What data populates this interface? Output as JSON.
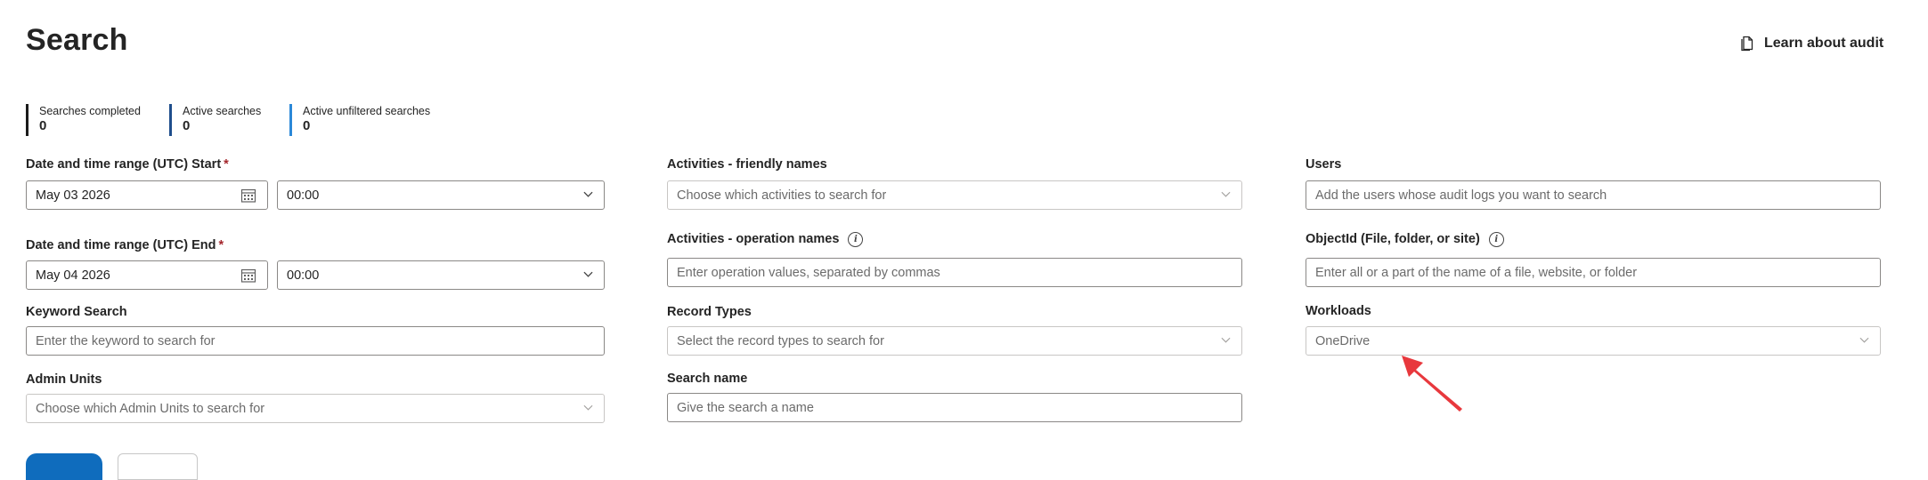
{
  "page": {
    "title": "Search",
    "learn_link": "Learn about audit"
  },
  "stats": [
    {
      "label": "Searches completed",
      "value": "0"
    },
    {
      "label": "Active searches",
      "value": "0"
    },
    {
      "label": "Active unfiltered searches",
      "value": "0"
    }
  ],
  "form": {
    "start": {
      "label": "Date and time range (UTC) Start",
      "required": "*",
      "date": "May 03 2026",
      "time": "00:00"
    },
    "end": {
      "label": "Date and time range (UTC) End",
      "required": "*",
      "date": "May 04 2026",
      "time": "00:00"
    },
    "keyword": {
      "label": "Keyword Search",
      "placeholder": "Enter the keyword to search for"
    },
    "admin_units": {
      "label": "Admin Units",
      "placeholder": "Choose which Admin Units to search for"
    },
    "activities_friendly": {
      "label": "Activities - friendly names",
      "placeholder": "Choose which activities to search for"
    },
    "activities_operation": {
      "label": "Activities - operation names",
      "placeholder": "Enter operation values, separated by commas"
    },
    "record_types": {
      "label": "Record Types",
      "placeholder": "Select the record types to search for"
    },
    "search_name": {
      "label": "Search name",
      "placeholder": "Give the search a name"
    },
    "users": {
      "label": "Users",
      "placeholder": "Add the users whose audit logs you want to search"
    },
    "object_id": {
      "label": "ObjectId (File, folder, or site)",
      "placeholder": "Enter all or a part of the name of a file, website, or folder"
    },
    "workloads": {
      "label": "Workloads",
      "value": "OneDrive"
    }
  },
  "colors": {
    "accent": "#0f6cbd",
    "required": "#a4262c",
    "annotation_arrow": "#e8383d"
  },
  "icons": [
    "document-icon",
    "calendar-icon",
    "chevron-down-icon",
    "info-icon",
    "arrow-annotation"
  ]
}
